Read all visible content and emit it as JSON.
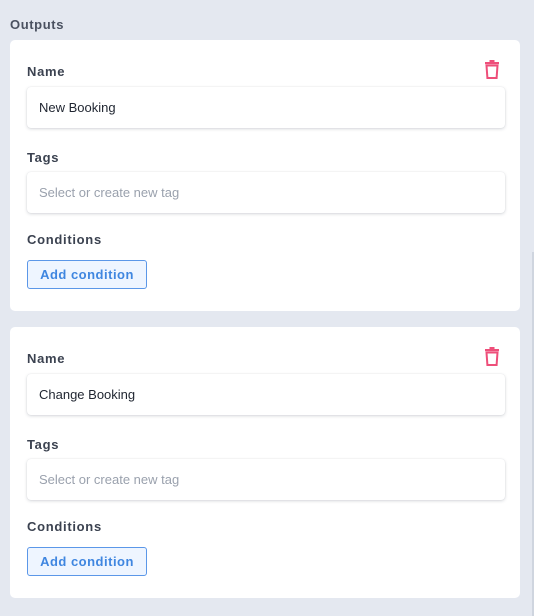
{
  "section": {
    "title": "Outputs"
  },
  "colors": {
    "accent": "#3f86e0",
    "delete": "#ee4f7a",
    "background": "#e4e8f0"
  },
  "outputs": [
    {
      "name_label": "Name",
      "name_value": "New Booking",
      "tags_label": "Tags",
      "tags_placeholder": "Select or create new tag",
      "conditions_label": "Conditions",
      "add_condition_label": "Add condition",
      "delete_icon": "trash-icon"
    },
    {
      "name_label": "Name",
      "name_value": "Change Booking",
      "tags_label": "Tags",
      "tags_placeholder": "Select or create new tag",
      "conditions_label": "Conditions",
      "add_condition_label": "Add condition",
      "delete_icon": "trash-icon"
    }
  ]
}
